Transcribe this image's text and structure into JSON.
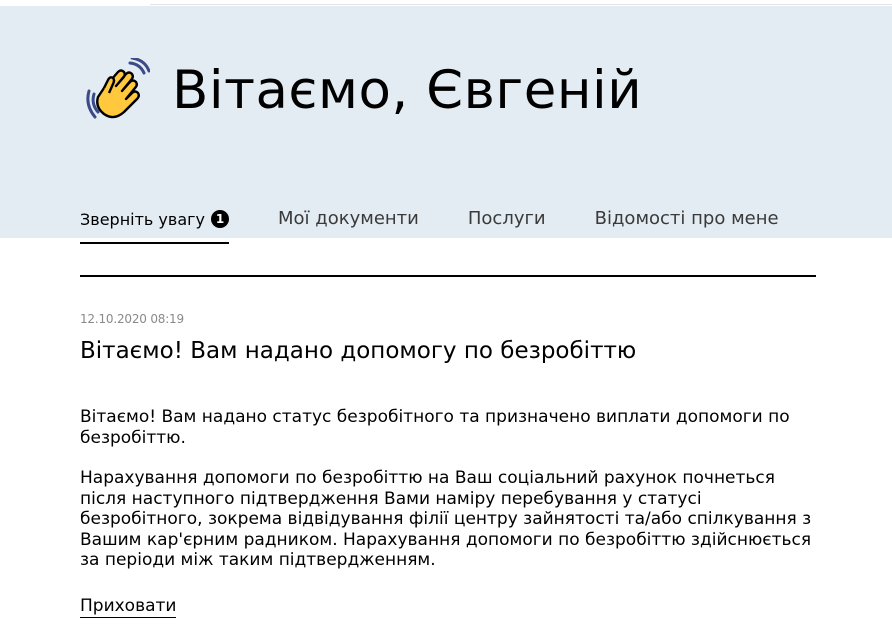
{
  "header": {
    "greeting": "Вітаємо, Євгеній",
    "icon": "waving-hand-icon"
  },
  "tabs": [
    {
      "label": "Зверніть увагу",
      "badge": "1",
      "active": true
    },
    {
      "label": "Мої документи",
      "active": false
    },
    {
      "label": "Послуги",
      "active": false
    },
    {
      "label": "Відомості про мене",
      "active": false
    }
  ],
  "message": {
    "timestamp": "12.10.2020 08:19",
    "title": "Вітаємо! Вам надано допомогу по безробіттю",
    "paragraph1": "Вітаємо! Вам надано статус безробітного та призначено виплати допомоги по безробіттю.",
    "paragraph2": "Нарахування допомоги по безробіттю на Ваш соціальний рахунок почнеться після наступного підтвердження Вами наміру перебування у статусі безробітного, зокрема відвідування філії центру зайнятості та/або спілкування з Вашим кар'єрним радником. Нарахування допомоги по безробіттю здійснюється за періоди між таким підтвердженням.",
    "hide_label": "Приховати"
  },
  "colors": {
    "header_background": "#e3ebf3",
    "text": "#000000",
    "muted": "#8a8a8a",
    "wave": "#ffc83d"
  }
}
